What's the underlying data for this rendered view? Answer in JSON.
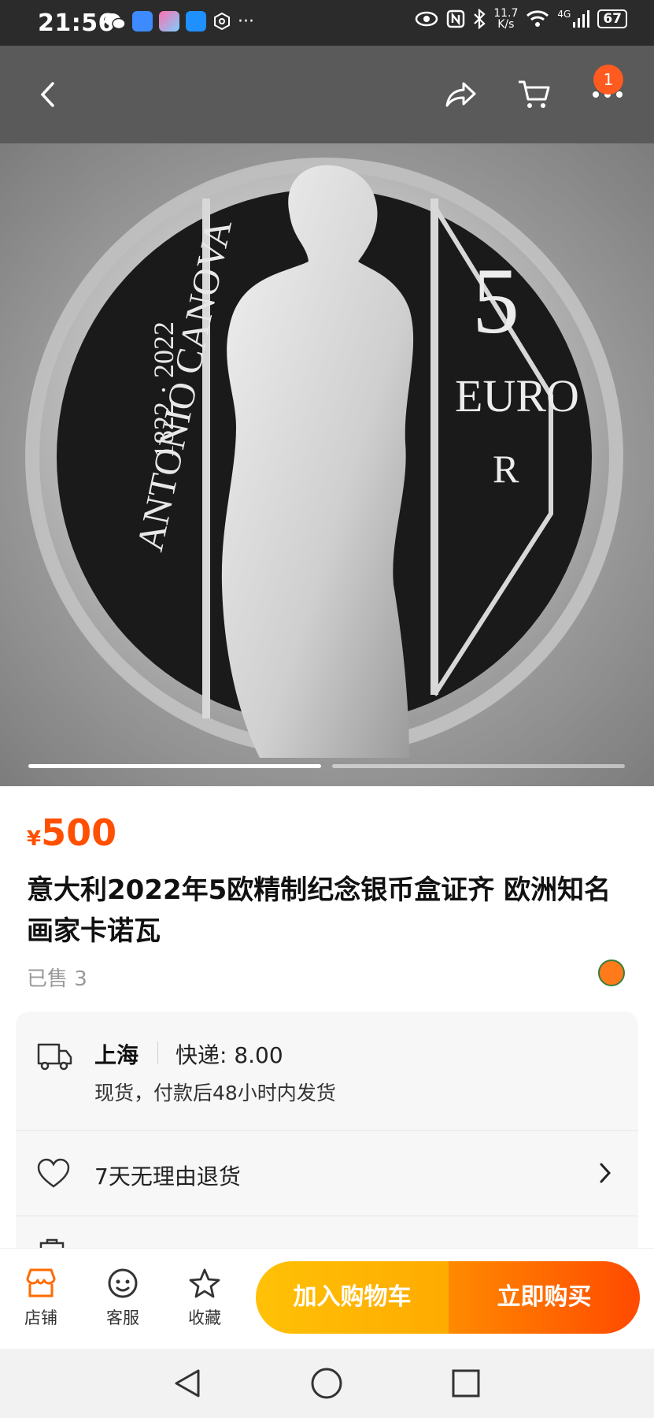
{
  "status_bar": {
    "time": "21:56",
    "network_speed": "11.7\nK/s",
    "speed_value": "11.7",
    "speed_unit": "K/s",
    "signal_type": "4G",
    "battery": "67"
  },
  "nav": {
    "cart_badge": "1"
  },
  "hero": {
    "coin_text_name": "ANTONIO CANOVA",
    "coin_text_years": "1822 · 2022",
    "coin_denomination": "5",
    "coin_currency": "EURO",
    "coin_mark": "R",
    "image_count": 2,
    "active_index": 0
  },
  "product": {
    "currency_symbol": "¥",
    "price": "500",
    "title": "意大利2022年5欧精制纪念银币盒证齐 欧洲知名画家卡诺瓦",
    "sold": "已售 3"
  },
  "shipping": {
    "location": "上海",
    "express": "快递: 8.00",
    "note": "现货，付款后48小时内发货"
  },
  "service": {
    "returns": "7天无理由退货"
  },
  "bottom_bar": {
    "shop_label": "店铺",
    "service_label": "客服",
    "favorite_label": "收藏",
    "add_to_cart": "加入购物车",
    "buy_now": "立即购买"
  },
  "colors": {
    "accent": "#ff5000",
    "cart_button": "#ffb300",
    "buy_button": "#ff5a00"
  }
}
